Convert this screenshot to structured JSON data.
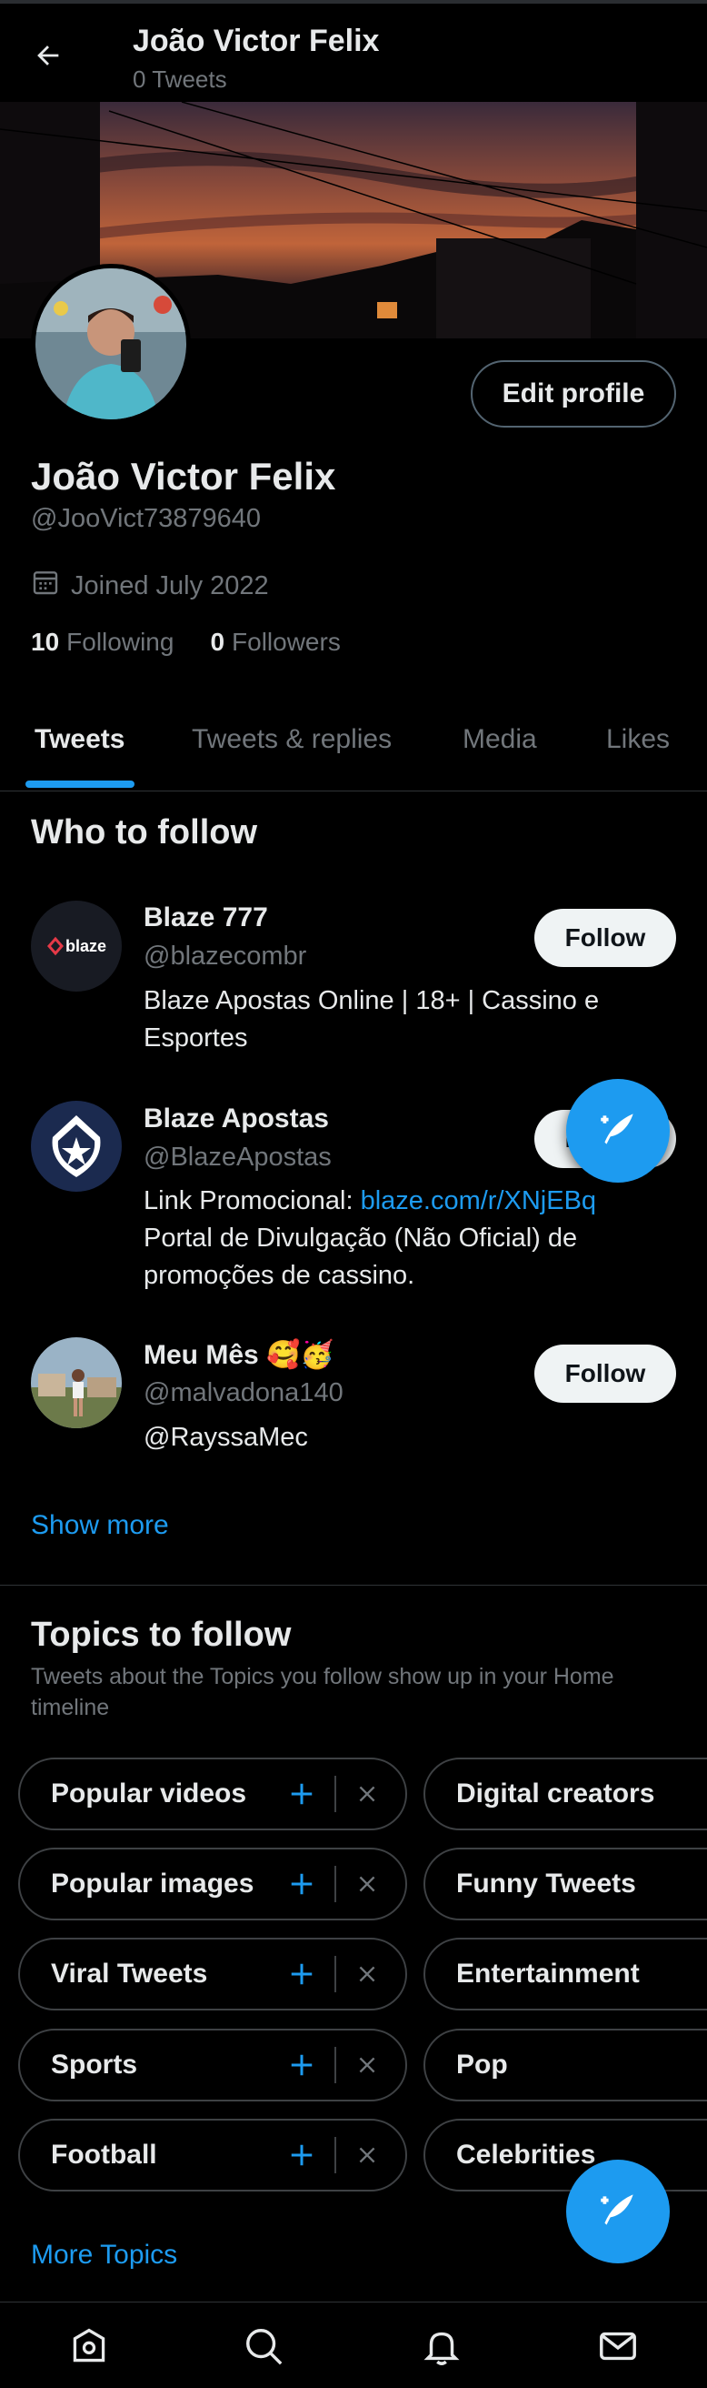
{
  "header": {
    "name": "João Victor Felix",
    "tweet_count": "0 Tweets"
  },
  "profile": {
    "name": "João Victor Felix",
    "handle": "@JooVict73879640",
    "joined": "Joined July 2022",
    "edit_label": "Edit profile",
    "following_count": "10",
    "following_label": "Following",
    "followers_count": "0",
    "followers_label": "Followers"
  },
  "tabs": [
    {
      "label": "Tweets",
      "active": true
    },
    {
      "label": "Tweets & replies",
      "active": false
    },
    {
      "label": "Media",
      "active": false
    },
    {
      "label": "Likes",
      "active": false
    }
  ],
  "who_to_follow": {
    "title": "Who to follow",
    "follow_label": "Follow",
    "show_more": "Show more",
    "accounts": [
      {
        "name": "Blaze 777",
        "handle": "@blazecombr",
        "bio": "Blaze Apostas Online | 18+ | Cassino e Esportes",
        "avatar_text": "blaze"
      },
      {
        "name": "Blaze Apostas",
        "handle": "@BlazeApostas",
        "bio_prefix": "Link Promocional: ",
        "bio_link": "blaze.com/r/XNjEBq",
        "bio_rest": "Portal de Divulgação (Não Oficial) de promoções de cassino."
      },
      {
        "name": "Meu Mês 🥰🥳",
        "handle": "@malvadona140",
        "bio_link": "@RayssaMec"
      }
    ]
  },
  "topics": {
    "title": "Topics to follow",
    "subtitle": "Tweets about the Topics you follow show up in your Home timeline",
    "left": [
      "Popular videos",
      "Popular images",
      "Viral Tweets",
      "Sports",
      "Football"
    ],
    "right": [
      "Digital creators",
      "Funny Tweets",
      "Entertainment",
      "Pop",
      "Celebrities"
    ],
    "more": "More Topics"
  },
  "colors": {
    "accent": "#1d9bf0",
    "background": "#000000",
    "text": "#e7e9ea",
    "muted": "#71767b"
  },
  "icons": [
    "back-arrow-icon",
    "calendar-icon",
    "compose-tweet-icon",
    "plus-icon",
    "close-icon",
    "home-icon",
    "search-icon",
    "notifications-icon",
    "messages-icon"
  ]
}
